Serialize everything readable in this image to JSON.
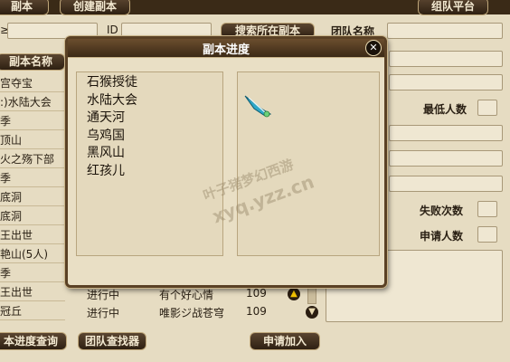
{
  "toolbar": {
    "fuben_button": "副本",
    "create_button": "创建副本",
    "platform_button": "组队平台"
  },
  "header": {
    "id_label": "ID",
    "search_button": "搜索所在副本",
    "team_name_label": "团队名称"
  },
  "left_list": {
    "column_header": "副本名称",
    "items": [
      "宫夺宝",
      ":)水陆大会",
      "季",
      "顶山",
      "火之殇下部",
      "季",
      "底洞",
      "底洞",
      "王出世",
      "艳山(5人)",
      "季",
      "王出世",
      "冠丘"
    ]
  },
  "right_labels": {
    "min_people": "最低人数",
    "fail_count": "失败次数",
    "applicants": "申请人数"
  },
  "table_rows": [
    {
      "status": "进行中",
      "name": "有个好心情",
      "level": "109"
    },
    {
      "status": "进行中",
      "name": "唯影ジ战苍穹",
      "level": "109"
    }
  ],
  "bottom": {
    "progress_query_button": "本进度查询",
    "team_finder_button": "团队查找器",
    "apply_button": "申请加入"
  },
  "dialog": {
    "title": "副本进度",
    "close_glyph": "✕",
    "dungeons": [
      "石猴授徒",
      "水陆大会",
      "通天河",
      "乌鸡国",
      "黑风山",
      "红孩儿"
    ]
  },
  "watermark": {
    "line1": "叶子猪梦幻西游",
    "line2": "xyq.yzz.cn"
  }
}
